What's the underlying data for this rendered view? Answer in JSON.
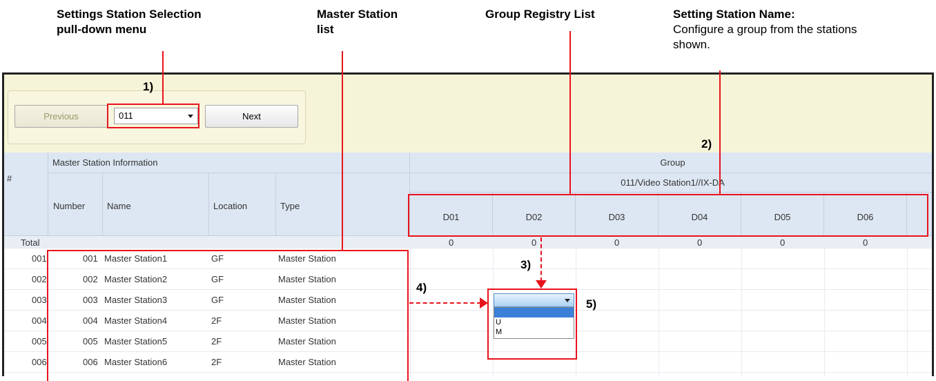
{
  "callouts": {
    "settings_selection": [
      "Settings Station Selection",
      "pull-down menu"
    ],
    "master_list": [
      "Master Station",
      "list"
    ],
    "group_registry": "Group Registry List",
    "setting_name_title": "Setting Station Name:",
    "setting_name_desc1": "Configure a group from the stations",
    "setting_name_desc2": "shown."
  },
  "markers": {
    "m1": "1)",
    "m2": "2)",
    "m3": "3)",
    "m4": "4)",
    "m5": "5)"
  },
  "toolbar": {
    "previous_label": "Previous",
    "station_value": "011",
    "next_label": "Next"
  },
  "table": {
    "hash_header": "#",
    "master_info_header": "Master Station Information",
    "columns": {
      "number": "Number",
      "name": "Name",
      "location": "Location",
      "type": "Type"
    },
    "group_header": "Group",
    "group_station": "011/Video Station1//IX-DA",
    "group_cols": [
      "D01",
      "D02",
      "D03",
      "D04",
      "D05",
      "D06"
    ],
    "total_label": "Total",
    "totals": [
      "0",
      "0",
      "0",
      "0",
      "0",
      "0"
    ],
    "rows": [
      {
        "idx": "001",
        "number": "001",
        "name": "Master Station1",
        "location": "GF",
        "type": "Master Station"
      },
      {
        "idx": "002",
        "number": "002",
        "name": "Master Station2",
        "location": "GF",
        "type": "Master Station"
      },
      {
        "idx": "003",
        "number": "003",
        "name": "Master Station3",
        "location": "GF",
        "type": "Master Station"
      },
      {
        "idx": "004",
        "number": "004",
        "name": "Master Station4",
        "location": "2F",
        "type": "Master Station"
      },
      {
        "idx": "005",
        "number": "005",
        "name": "Master Station5",
        "location": "2F",
        "type": "Master Station"
      },
      {
        "idx": "006",
        "number": "006",
        "name": "Master Station6",
        "location": "2F",
        "type": "Master Station"
      }
    ]
  },
  "dropdown": {
    "value": "",
    "options": [
      "",
      "U",
      "M"
    ]
  },
  "colors": {
    "annotation": "#e8121b",
    "header_bg": "#dde7f3",
    "top_band": "#f6f4d8"
  }
}
